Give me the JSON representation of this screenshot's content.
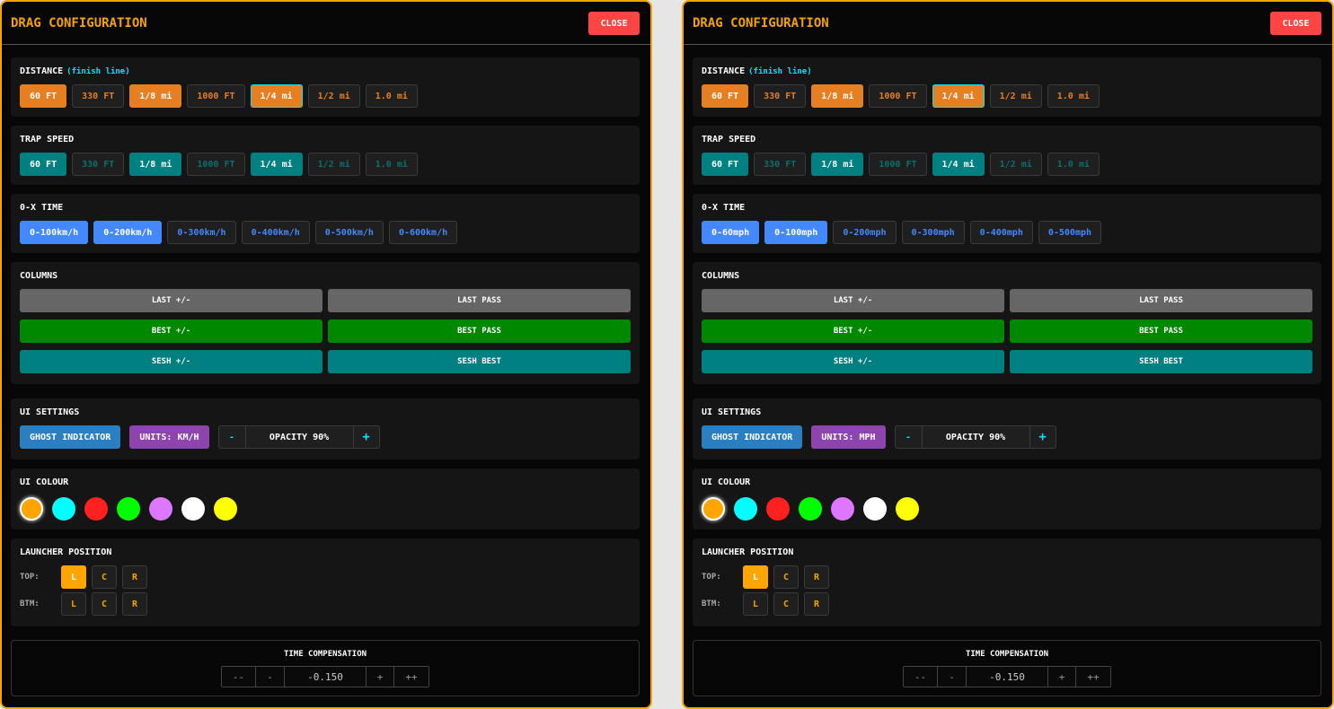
{
  "panels": [
    {
      "title": "DRAG CONFIGURATION",
      "close": "CLOSE",
      "distance": {
        "label": "DISTANCE",
        "sub": "(finish line)",
        "options": [
          {
            "t": "60 FT",
            "on": true
          },
          {
            "t": "330 FT",
            "on": false
          },
          {
            "t": "1/8 mi",
            "on": true
          },
          {
            "t": "1000 FT",
            "on": false
          },
          {
            "t": "1/4 mi",
            "on": true,
            "focus": true
          },
          {
            "t": "1/2 mi",
            "on": false
          },
          {
            "t": "1.0 mi",
            "on": false
          }
        ]
      },
      "trap": {
        "label": "TRAP SPEED",
        "options": [
          {
            "t": "60 FT",
            "on": true
          },
          {
            "t": "330 FT",
            "on": false
          },
          {
            "t": "1/8 mi",
            "on": true
          },
          {
            "t": "1000 FT",
            "on": false
          },
          {
            "t": "1/4 mi",
            "on": true
          },
          {
            "t": "1/2 mi",
            "on": false
          },
          {
            "t": "1.0 mi",
            "on": false
          }
        ]
      },
      "zerox": {
        "label": "0-X TIME",
        "options": [
          {
            "t": "0-100km/h",
            "on": true
          },
          {
            "t": "0-200km/h",
            "on": true
          },
          {
            "t": "0-300km/h",
            "on": false
          },
          {
            "t": "0-400km/h",
            "on": false
          },
          {
            "t": "0-500km/h",
            "on": false
          },
          {
            "t": "0-600km/h",
            "on": false
          }
        ]
      },
      "columns": {
        "label": "COLUMNS",
        "items": [
          "LAST +/-",
          "LAST PASS",
          "BEST +/-",
          "BEST PASS",
          "SESH +/-",
          "SESH BEST"
        ]
      },
      "ui": {
        "label": "UI SETTINGS",
        "ghost": "GHOST INDICATOR",
        "units": "UNITS: KM/H",
        "minus": "-",
        "opacity": "OPACITY 90%",
        "plus": "+"
      },
      "colour": {
        "label": "UI COLOUR",
        "swatches": [
          "#ffa500",
          "#00ffff",
          "#ff2020",
          "#00ff00",
          "#dd77ff",
          "#ffffff",
          "#ffff00"
        ],
        "selected": 0
      },
      "launcher": {
        "label": "LAUNCHER POSITION",
        "top": "TOP:",
        "btm": "BTM:",
        "opts": [
          "L",
          "C",
          "R"
        ],
        "top_sel": 0
      },
      "timecomp": {
        "label": "TIME COMPENSATION",
        "buttons": [
          "--",
          "-",
          "+",
          "++"
        ],
        "value": "-0.150"
      }
    },
    {
      "title": "DRAG CONFIGURATION",
      "close": "CLOSE",
      "distance": {
        "label": "DISTANCE",
        "sub": "(finish line)",
        "options": [
          {
            "t": "60 FT",
            "on": true
          },
          {
            "t": "330 FT",
            "on": false
          },
          {
            "t": "1/8 mi",
            "on": true
          },
          {
            "t": "1000 FT",
            "on": false
          },
          {
            "t": "1/4 mi",
            "on": true,
            "focus": true
          },
          {
            "t": "1/2 mi",
            "on": false
          },
          {
            "t": "1.0 mi",
            "on": false
          }
        ]
      },
      "trap": {
        "label": "TRAP SPEED",
        "options": [
          {
            "t": "60 FT",
            "on": true
          },
          {
            "t": "330 FT",
            "on": false
          },
          {
            "t": "1/8 mi",
            "on": true
          },
          {
            "t": "1000 FT",
            "on": false
          },
          {
            "t": "1/4 mi",
            "on": true
          },
          {
            "t": "1/2 mi",
            "on": false
          },
          {
            "t": "1.0 mi",
            "on": false
          }
        ]
      },
      "zerox": {
        "label": "0-X TIME",
        "options": [
          {
            "t": "0-60mph",
            "on": true
          },
          {
            "t": "0-100mph",
            "on": true
          },
          {
            "t": "0-200mph",
            "on": false
          },
          {
            "t": "0-300mph",
            "on": false
          },
          {
            "t": "0-400mph",
            "on": false
          },
          {
            "t": "0-500mph",
            "on": false
          }
        ]
      },
      "columns": {
        "label": "COLUMNS",
        "items": [
          "LAST +/-",
          "LAST PASS",
          "BEST +/-",
          "BEST PASS",
          "SESH +/-",
          "SESH BEST"
        ]
      },
      "ui": {
        "label": "UI SETTINGS",
        "ghost": "GHOST INDICATOR",
        "units": "UNITS: MPH",
        "minus": "-",
        "opacity": "OPACITY 90%",
        "plus": "+"
      },
      "colour": {
        "label": "UI COLOUR",
        "swatches": [
          "#ffa500",
          "#00ffff",
          "#ff2020",
          "#00ff00",
          "#dd77ff",
          "#ffffff",
          "#ffff00"
        ],
        "selected": 0
      },
      "launcher": {
        "label": "LAUNCHER POSITION",
        "top": "TOP:",
        "btm": "BTM:",
        "opts": [
          "L",
          "C",
          "R"
        ],
        "top_sel": 0
      },
      "timecomp": {
        "label": "TIME COMPENSATION",
        "buttons": [
          "--",
          "-",
          "+",
          "++"
        ],
        "value": "-0.150"
      }
    }
  ],
  "colors": {
    "accent": "#f5a300",
    "distance_on": "#e67e22",
    "trap_on": "#008080",
    "zerox_on": "#4488ff",
    "ghost": "#2b7fc0",
    "units": "#8e44ad",
    "close": "#ff4444",
    "col_last": "#666666",
    "col_best": "#008800",
    "col_sesh": "#008080"
  }
}
